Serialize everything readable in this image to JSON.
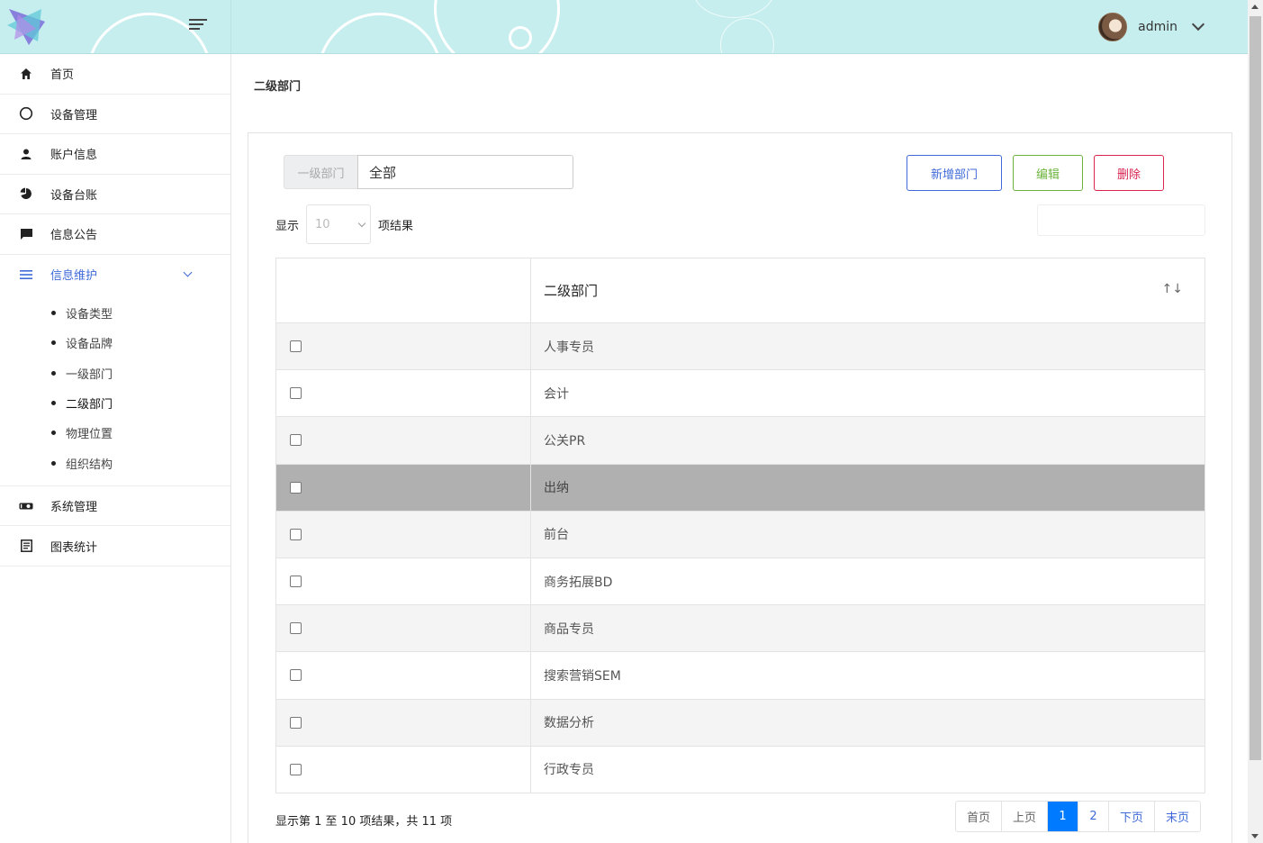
{
  "header": {
    "user_name": "admin"
  },
  "sidebar": {
    "items": [
      {
        "label": "首页",
        "icon": "home-icon"
      },
      {
        "label": "设备管理",
        "icon": "circle-icon"
      },
      {
        "label": "账户信息",
        "icon": "user-icon"
      },
      {
        "label": "设备台账",
        "icon": "pie-chart-icon"
      },
      {
        "label": "信息公告",
        "icon": "chat-icon"
      },
      {
        "label": "信息维护",
        "icon": "list-icon"
      },
      {
        "label": "系统管理",
        "icon": "toggle-icon"
      },
      {
        "label": "图表统计",
        "icon": "document-icon"
      }
    ],
    "sub_items": [
      "设备类型",
      "设备品牌",
      "一级部门",
      "二级部门",
      "物理位置",
      "组织结构"
    ]
  },
  "page": {
    "title": "二级部门"
  },
  "filter": {
    "label": "一级部门",
    "value": "全部"
  },
  "buttons": {
    "add": "新增部门",
    "edit": "编辑",
    "delete": "删除"
  },
  "length_menu": {
    "prefix": "显示",
    "value": "10",
    "suffix": "项结果"
  },
  "table": {
    "header": "二级部门",
    "sort_icon": "↑↓",
    "rows": [
      "人事专员",
      "会计",
      "公关PR",
      "出纳",
      "前台",
      "商务拓展BD",
      "商品专员",
      "搜索营销SEM",
      "数据分析",
      "行政专员"
    ]
  },
  "info": "显示第 1 至 10 项结果，共 11 项",
  "pagination": {
    "first": "首页",
    "prev": "上页",
    "pages": [
      "1",
      "2"
    ],
    "next": "下页",
    "last": "末页"
  },
  "colors": {
    "primary": "#3f6ad8",
    "success": "#6cb33e",
    "danger": "#d92550",
    "active_page": "#007bff",
    "header_bg": "#c7eeee"
  }
}
